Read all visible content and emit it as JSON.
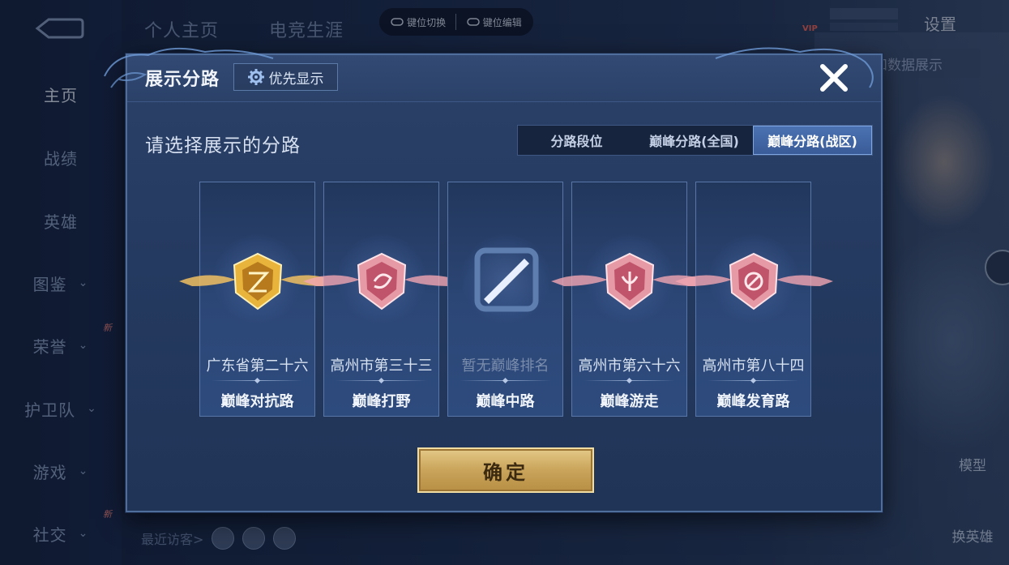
{
  "background": {
    "top_tabs": [
      "个人主页",
      "电竞生涯"
    ],
    "sidebar": [
      {
        "label": "主页",
        "active": true,
        "chevron": false,
        "new": false
      },
      {
        "label": "战绩",
        "active": false,
        "chevron": false,
        "new": false
      },
      {
        "label": "英雄",
        "active": false,
        "chevron": false,
        "new": false
      },
      {
        "label": "图鉴",
        "active": false,
        "chevron": true,
        "new": false
      },
      {
        "label": "荣誉",
        "active": false,
        "chevron": true,
        "new": true
      },
      {
        "label": "护卫队",
        "active": false,
        "chevron": true,
        "new": false
      },
      {
        "label": "游戏",
        "active": false,
        "chevron": true,
        "new": false
      },
      {
        "label": "社交",
        "active": false,
        "chevron": true,
        "new": true
      }
    ],
    "new_badge": "新",
    "key_bar": {
      "switch_label": "键位切换",
      "edit_label": "键位编辑"
    },
    "settings_label": "设置",
    "vip_label": "VIP",
    "data_pill": "和数据展示",
    "recent_visitors_label": "最近访客>",
    "model_label": "模型",
    "change_hero_label": "换英雄"
  },
  "dialog": {
    "title": "展示分路",
    "priority_label": "优先显示",
    "prompt": "请选择展示的分路",
    "segments": [
      "分路段位",
      "巅峰分路(全国)",
      "巅峰分路(战区)"
    ],
    "active_segment": 2,
    "cards": [
      {
        "rank": "广东省第二十六",
        "lane": "巅峰对抗路",
        "emblem": "gold-crest-icon",
        "dim": false
      },
      {
        "rank": "高州市第三十三",
        "lane": "巅峰打野",
        "emblem": "pink-crest-icon",
        "dim": false
      },
      {
        "rank": "暂无巅峰排名",
        "lane": "巅峰中路",
        "emblem": "empty-slash-icon",
        "dim": true
      },
      {
        "rank": "高州市第六十六",
        "lane": "巅峰游走",
        "emblem": "pink-crest-icon",
        "dim": false
      },
      {
        "rank": "高州市第八十四",
        "lane": "巅峰发育路",
        "emblem": "pink-crest-icon",
        "dim": false
      }
    ],
    "confirm_label": "确定"
  },
  "colors": {
    "gold": "#e4c987",
    "pink_emblem": "#e89aa6",
    "gold_emblem": "#f2c14a",
    "active_segment": "#4b72b2"
  }
}
